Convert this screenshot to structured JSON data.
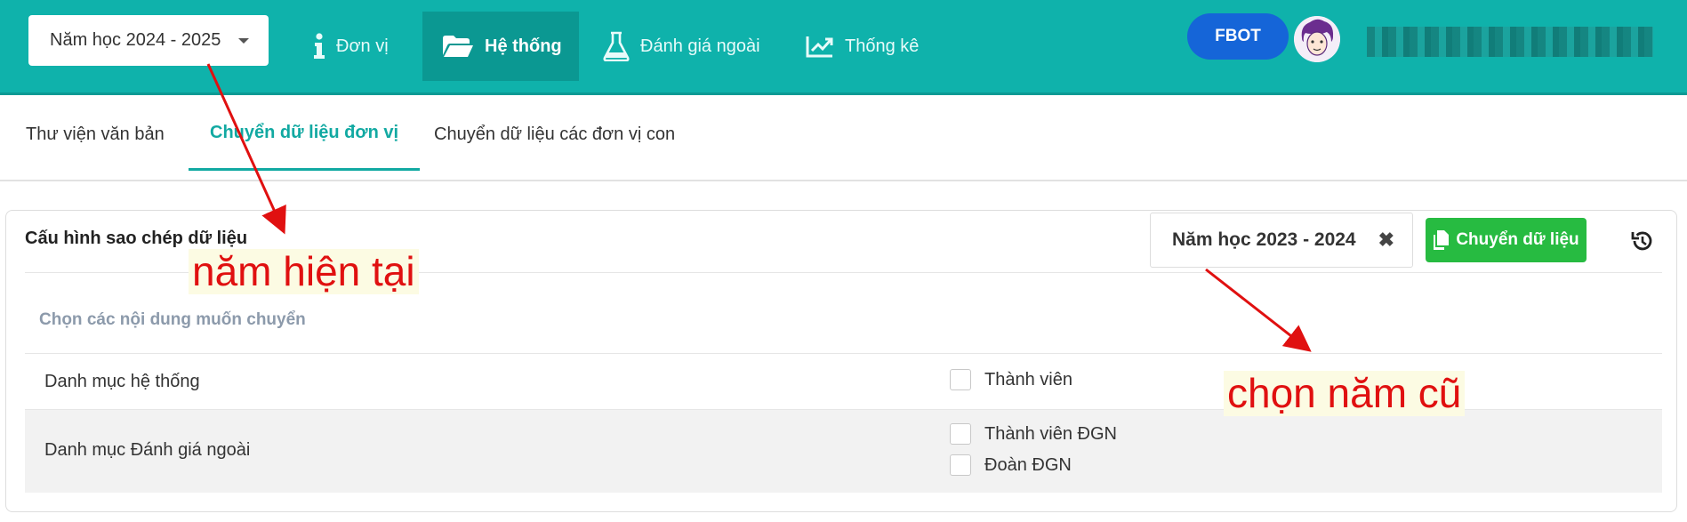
{
  "header": {
    "year_select": "Năm học 2024 - 2025",
    "nav": [
      {
        "label": "Đơn vị",
        "icon": "info-icon"
      },
      {
        "label": "Hệ thống",
        "icon": "folder-open-icon"
      },
      {
        "label": "Đánh giá ngoài",
        "icon": "flask-icon"
      },
      {
        "label": "Thống kê",
        "icon": "chart-line-icon"
      }
    ],
    "fbot_label": "FBOT"
  },
  "tabs": [
    {
      "label": "Thư viện văn bản"
    },
    {
      "label": "Chuyển dữ liệu đơn vị"
    },
    {
      "label": "Chuyển dữ liệu các đơn vị con"
    }
  ],
  "card": {
    "title": "Cấu hình sao chép dữ liệu",
    "old_year": "Năm học 2023 - 2024",
    "clear_symbol": "✖",
    "transfer_label": "Chuyển dữ liệu",
    "section_label": "Chọn các nội dung muốn chuyển",
    "rows": [
      {
        "label": "Danh mục hệ thống",
        "options": [
          "Thành viên"
        ]
      },
      {
        "label": "Danh mục Đánh giá ngoài",
        "options": [
          "Thành viên ĐGN",
          "Đoàn ĐGN"
        ]
      }
    ]
  },
  "annotations": {
    "current_year": "năm hiện tại",
    "old_year": "chọn năm cũ"
  },
  "colors": {
    "header_bg": "#0fb2ab",
    "active_tab": "#12a9a2",
    "fbot_bg": "#1565d8",
    "transfer_btn": "#27bb41",
    "annotation_red": "#e01010"
  }
}
